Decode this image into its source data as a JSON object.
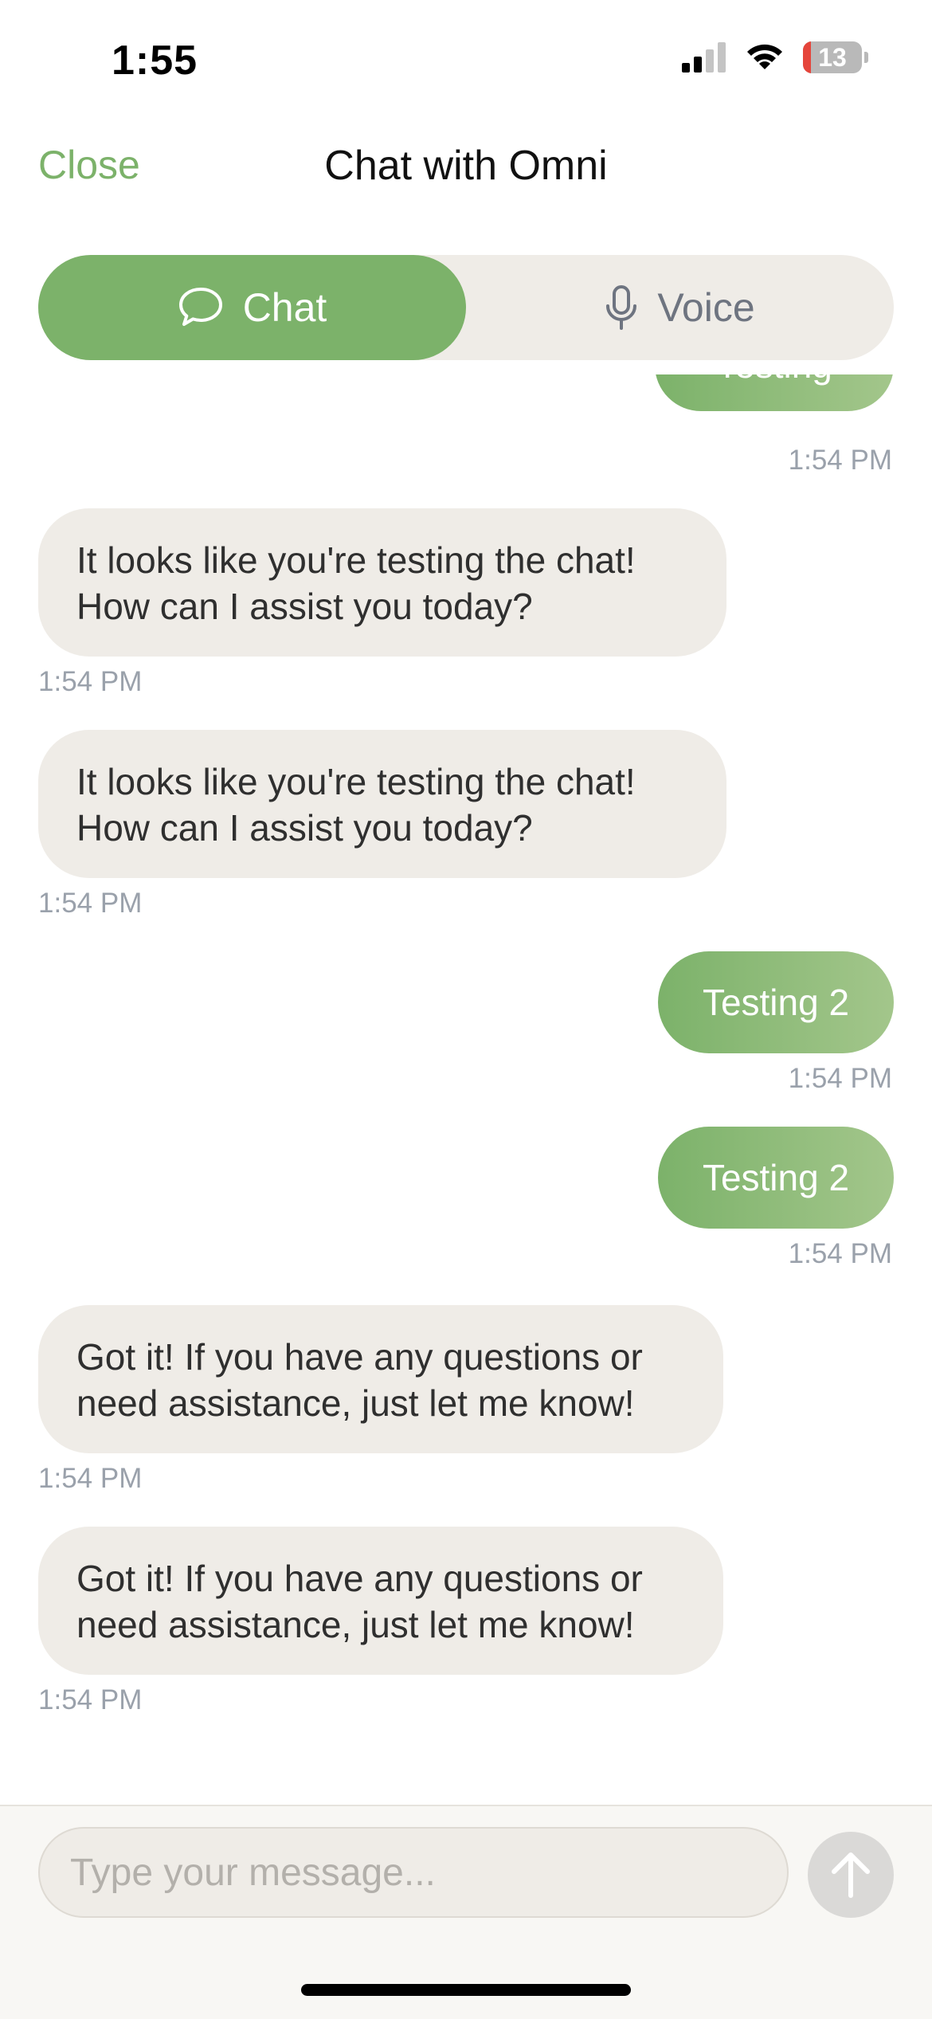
{
  "status_bar": {
    "time": "1:55",
    "battery": "13",
    "battery_level_percent": 13,
    "icons": [
      "cellular-signal-icon",
      "wifi-icon",
      "battery-icon"
    ]
  },
  "header": {
    "close_label": "Close",
    "title": "Chat with Omni"
  },
  "mode_tabs": [
    {
      "label": "Chat",
      "icon": "chat-bubble-icon",
      "selected": true
    },
    {
      "label": "Voice",
      "icon": "microphone-icon",
      "selected": false
    }
  ],
  "messages": [
    {
      "sender": "user",
      "text": "Testing",
      "time": "1:54 PM"
    },
    {
      "sender": "assistant",
      "text": "It looks like you're testing the chat! How can I assist you today?",
      "time": "1:54 PM"
    },
    {
      "sender": "assistant",
      "text": "It looks like you're testing the chat! How can I assist you today?",
      "time": "1:54 PM"
    },
    {
      "sender": "user",
      "text": "Testing 2",
      "time": "1:54 PM"
    },
    {
      "sender": "user",
      "text": "Testing 2",
      "time": "1:54 PM"
    },
    {
      "sender": "assistant",
      "text": "Got it! If you have any questions or need assistance, just let me know!",
      "time": "1:54 PM"
    },
    {
      "sender": "assistant",
      "text": "Got it! If you have any questions or need assistance, just let me know!",
      "time": "1:54 PM"
    }
  ],
  "composer": {
    "placeholder": "Type your message...",
    "value": "",
    "send_icon": "arrow-up-icon"
  },
  "colors": {
    "accent": "#7cb26a",
    "bot_bubble": "#efece7",
    "timestamp": "#9aa1ab",
    "battery_low": "#e5453b"
  }
}
